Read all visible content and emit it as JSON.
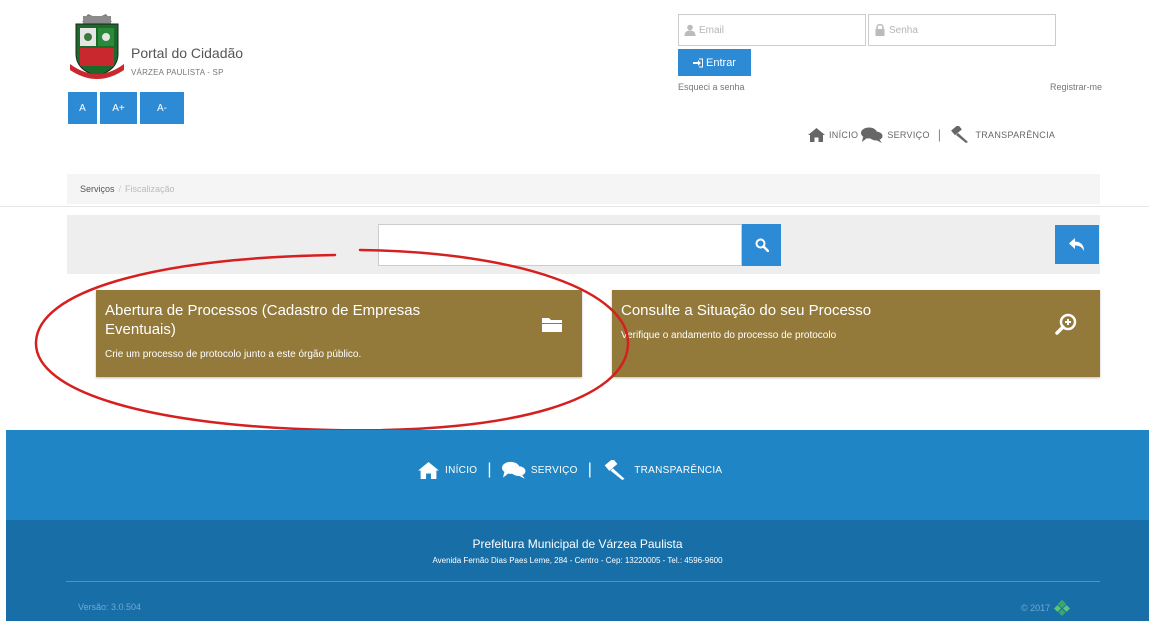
{
  "header": {
    "title": "Portal do Cidadão",
    "subtitle": "VÁRZEA PAULISTA - SP",
    "font_buttons": [
      "A",
      "A+",
      "A-"
    ]
  },
  "login": {
    "email_placeholder": "Email",
    "password_placeholder": "Senha",
    "submit_label": "Entrar",
    "forgot_label": "Esqueci a senha",
    "register_label": "Registrar-me"
  },
  "nav": {
    "items": [
      {
        "label": "INÍCIO",
        "icon": "home-icon"
      },
      {
        "label": "SERVIÇO",
        "icon": "comments-icon"
      },
      {
        "label": "TRANSPARÊNCIA",
        "icon": "gavel-icon"
      }
    ]
  },
  "breadcrumb": {
    "items": [
      "Serviços",
      "Fiscalização"
    ]
  },
  "search": {
    "value": ""
  },
  "cards": [
    {
      "title": "Abertura de Processos (Cadastro de Empresas Eventuais)",
      "description": "Crie um processo de protocolo junto a este órgão público.",
      "icon": "folder-open-icon"
    },
    {
      "title": "Consulte a Situação do seu Processo",
      "description": "Verifique o andamento do processo de protocolo",
      "icon": "search-plus-icon"
    }
  ],
  "footer": {
    "org_name": "Prefeitura Municipal de Várzea Paulista",
    "address": "Avenida Fernão Dias Paes Leme, 284 - Centro - Cep: 13220005 - Tel.: 4596-9600",
    "version": "Versão: 3.0.504",
    "copyright": "© 2017"
  },
  "colors": {
    "primary_blue": "#2d8bd6",
    "card_gold": "#93793a",
    "footer_top": "#1f85c4",
    "footer_bottom": "#186ea6",
    "annotation_red": "#d62020"
  }
}
